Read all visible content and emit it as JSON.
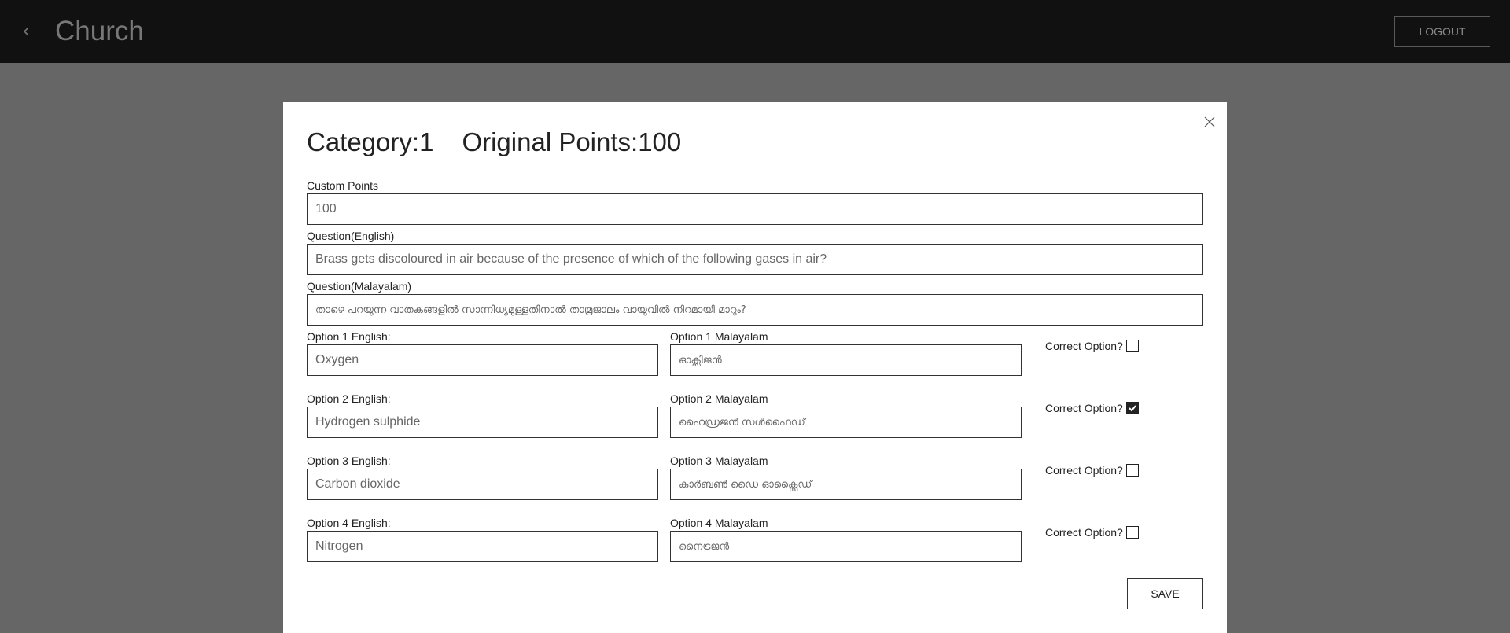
{
  "header": {
    "back_icon": "chevron-left-icon",
    "title": "Church",
    "logout_label": "LOGOUT"
  },
  "modal": {
    "close_icon": "close-icon",
    "category_text": "Category:1",
    "original_points_text": "Original Points:100",
    "custom_points": {
      "label": "Custom Points",
      "value": "100"
    },
    "question_english": {
      "label": "Question(English)",
      "value": "Brass gets discoloured in air because of the presence of which of the following gases in air?"
    },
    "question_malayalam": {
      "label": "Question(Malayalam)",
      "value": "താഴെ പറയുന്ന വാതകങ്ങളിൽ സാന്നിധ്യമുള്ളതിനാൽ താമ്രജാലം വായുവിൽ നിറമായി മാറും?"
    },
    "options": [
      {
        "english_label": "Option 1 English:",
        "english_value": "Oxygen",
        "malayalam_label": "Option 1 Malayalam",
        "malayalam_value": "ഓക്സിജൻ",
        "correct_label": "Correct Option?",
        "correct": false
      },
      {
        "english_label": "Option 2 English:",
        "english_value": "Hydrogen sulphide",
        "malayalam_label": "Option 2 Malayalam",
        "malayalam_value": "ഹൈഡ്രജൻ സൾഫൈഡ്",
        "correct_label": "Correct Option?",
        "correct": true
      },
      {
        "english_label": "Option 3 English:",
        "english_value": "Carbon dioxide",
        "malayalam_label": "Option 3 Malayalam",
        "malayalam_value": "കാർബൺ ഡൈ ഓക്സൈഡ്",
        "correct_label": "Correct Option?",
        "correct": false
      },
      {
        "english_label": "Option 4 English:",
        "english_value": "Nitrogen",
        "malayalam_label": "Option 4 Malayalam",
        "malayalam_value": "നൈട്രജൻ",
        "correct_label": "Correct Option?",
        "correct": false
      }
    ],
    "save_label": "SAVE"
  },
  "colors": {
    "header_bg": "#111111",
    "backdrop": "#666666",
    "modal_bg": "#ffffff",
    "text": "#222222"
  }
}
